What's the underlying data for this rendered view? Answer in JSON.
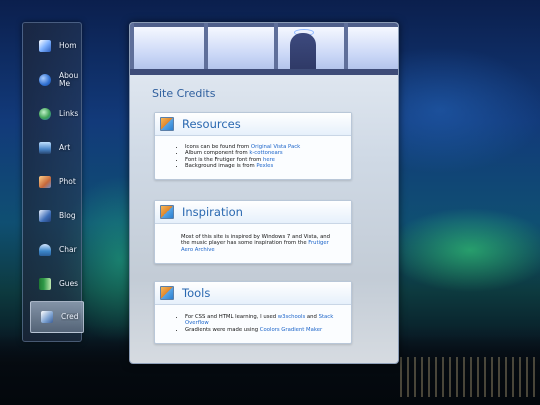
{
  "sidebar": {
    "items": [
      {
        "label": "Hom",
        "icon": "home-icon",
        "color": "#3c78d8"
      },
      {
        "label": "Abou Me",
        "icon": "info-icon",
        "color": "#2e6fd1"
      },
      {
        "label": "Links",
        "icon": "globe-icon",
        "color": "#3fa357"
      },
      {
        "label": "Art",
        "icon": "monitor-icon",
        "color": "#4a86c9"
      },
      {
        "label": "Phot",
        "icon": "photo-icon",
        "color": "#c6683a"
      },
      {
        "label": "Blog",
        "icon": "notepad-icon",
        "color": "#3e6eb8"
      },
      {
        "label": "Char",
        "icon": "people-icon",
        "color": "#3c86c9"
      },
      {
        "label": "Gues",
        "icon": "book-icon",
        "color": "#2f9a48"
      },
      {
        "label": "Cred",
        "icon": "credits-icon",
        "color": "#7aa0d0"
      }
    ],
    "active_index": 8
  },
  "page": {
    "title": "Site Credits"
  },
  "resources": {
    "title": "Resources",
    "items": [
      {
        "text": "Icons can be found from ",
        "link": "Original Vista Pack"
      },
      {
        "text": "Album component from ",
        "link": "k-cottonears"
      },
      {
        "text": "Font is the Frutiger font from ",
        "link": "here"
      },
      {
        "text": "Background image is from ",
        "link": "Pexles"
      }
    ]
  },
  "inspiration": {
    "title": "Inspiration",
    "text": "Most of this site is inspired by Windows 7 and Vista, and the music player has some inspiration from the ",
    "link": "Frutiger Aero Archive"
  },
  "tools": {
    "title": "Tools",
    "item1_text": "For CSS and HTML learning, I used ",
    "item1_link1": "w3schools",
    "item1_mid": " and ",
    "item1_link2": "Stack Overflow",
    "item2_text": "Gradients were made using ",
    "item2_link": "Coolors Gradient Maker"
  }
}
